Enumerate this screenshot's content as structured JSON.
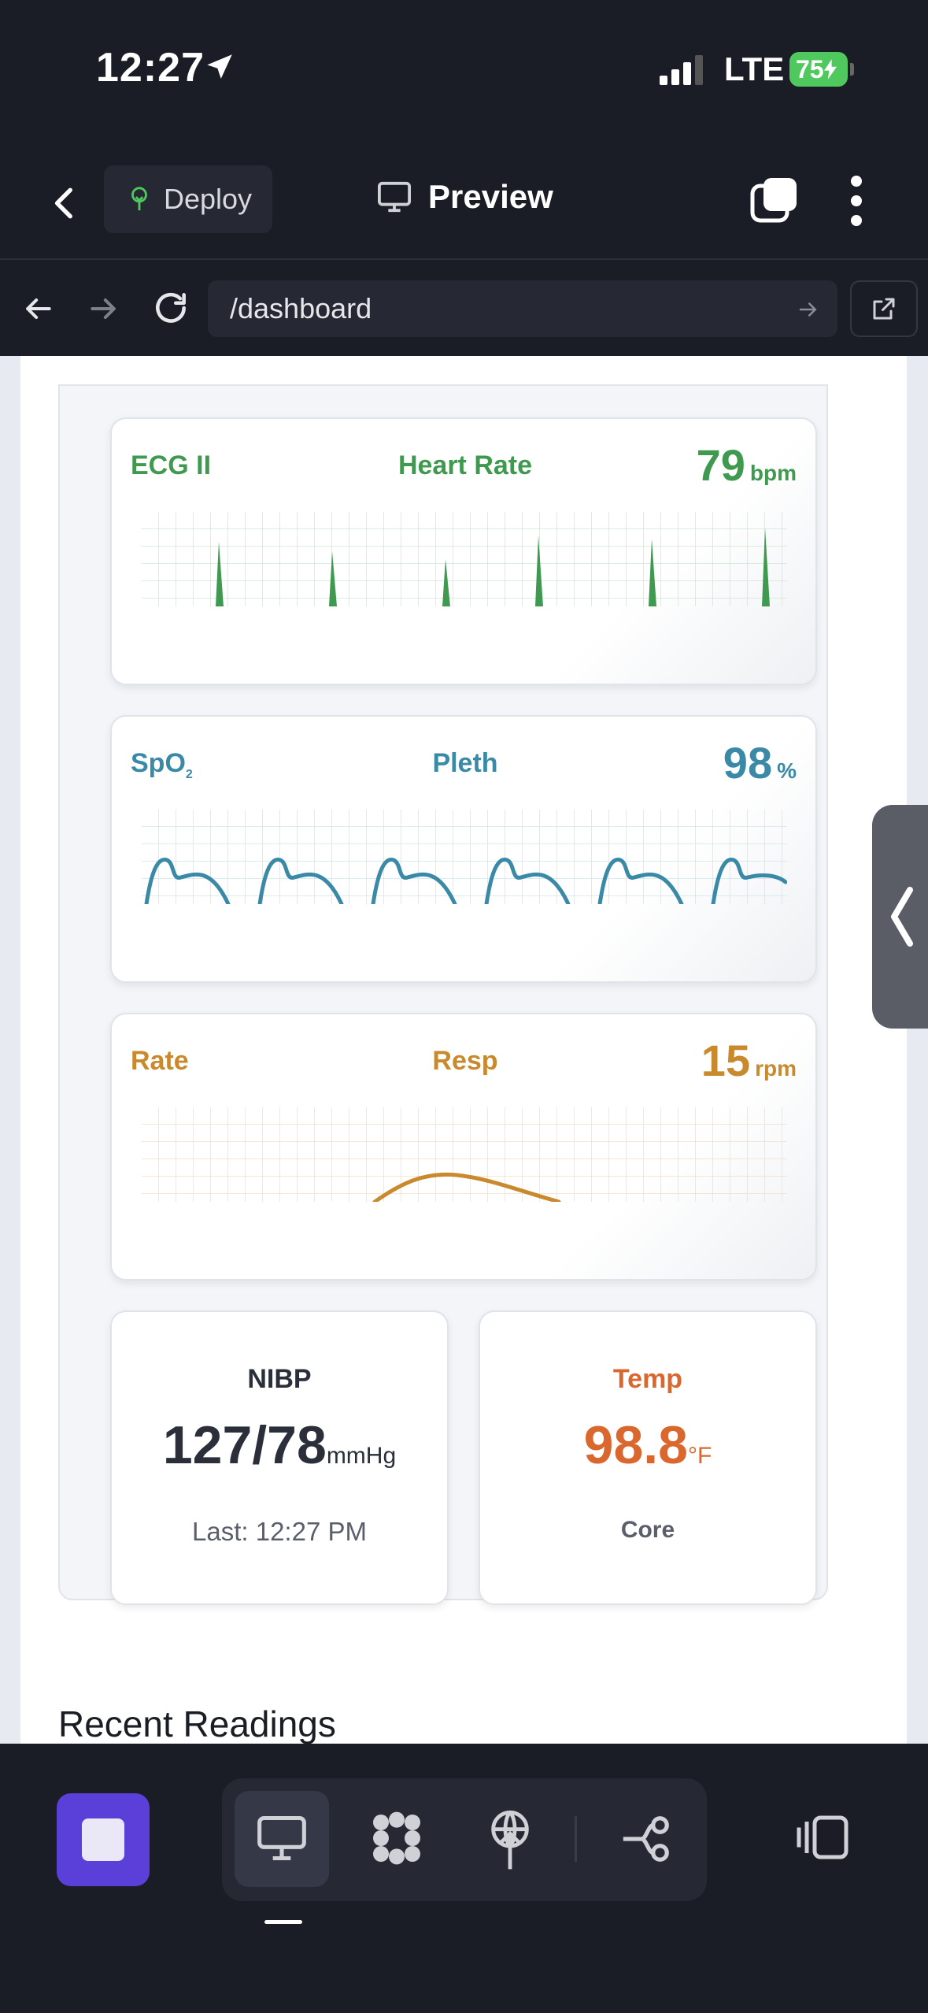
{
  "status_bar": {
    "time": "12:27",
    "network": "LTE",
    "battery": "75"
  },
  "app_header": {
    "deploy_label": "Deploy",
    "preview_label": "Preview"
  },
  "url_bar": {
    "path": "/dashboard"
  },
  "monitor": {
    "ecg": {
      "label": "ECG II",
      "title": "Heart Rate",
      "value": "79",
      "unit": "bpm",
      "color": "#3f9a50"
    },
    "spo2": {
      "label_main": "SpO",
      "label_sub": "2",
      "title": "Pleth",
      "value": "98",
      "unit": "%",
      "color": "#3a8aa7"
    },
    "resp": {
      "label": "Rate",
      "title": "Resp",
      "value": "15",
      "unit": "rpm",
      "color": "#c98a2d"
    },
    "nibp": {
      "title": "NIBP",
      "value": "127/78",
      "unit": "mmHg",
      "last": "Last: 12:27 PM"
    },
    "temp": {
      "title": "Temp",
      "value": "98.8",
      "unit": "°F",
      "site": "Core",
      "color": "#d9672e"
    }
  },
  "section": {
    "recent_readings": "Recent Readings"
  },
  "icons": [
    "location-arrow-icon",
    "signal-icon",
    "chevron-left-icon",
    "sprout-icon",
    "monitor-icon",
    "tabs-icon",
    "more-vertical-icon",
    "arrow-left-icon",
    "arrow-right-icon",
    "reload-icon",
    "external-link-icon",
    "stop-icon",
    "flower-icon",
    "antenna-icon",
    "workflow-icon",
    "panel-icon"
  ]
}
